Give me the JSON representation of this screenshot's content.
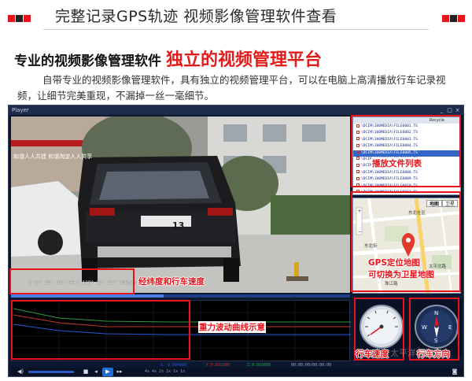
{
  "header": {
    "title": "完整记录GPS轨迹 视频影像管理软件查看",
    "accent_colors": [
      "#e8141b",
      "#222222"
    ]
  },
  "heading": {
    "black": "专业的视频影像管理软件",
    "red": "独立的视频管理平台"
  },
  "paragraph": "自带专业的视频影像管理软件，具有独立的视频管理平台，可以在电脑上高清播放行车记录视频，让细节完美重现，不漏掉一丝一毫细节。",
  "player": {
    "window_title": "Player",
    "window_buttons": [
      "_",
      "□",
      "×"
    ],
    "video": {
      "gps_overlay": "N 31° 59' 59\" 56  E 118° 23' 27\" 30km/h",
      "plate": "13",
      "street_banner": "和谐人人共建  和谐淘淀人人共享"
    },
    "seek_progress": 0.45,
    "file_list": {
      "header": "Recycle",
      "files": [
        "\\DCIM\\100MEDIA\\FILE0001.TS",
        "\\DCIM\\100MEDIA\\FILE0002.TS",
        "\\DCIM\\100MEDIA\\FILE0003.TS",
        "\\DCIM\\100MEDIA\\FILE0004.TS",
        "\\DCIM\\100MEDIA\\FILE0005.TS",
        "\\DCIM\\100MEDIA\\FILE0006.TS",
        "\\DCIM\\100MEDIA\\FILE0007.TS",
        "\\DCIM\\100MEDIA\\FILE0008.TS",
        "\\DCIM\\100MEDIA\\FILE0009.TS",
        "\\DCIM\\100MEDIA\\FILE0010.TS",
        "\\DCIM\\100MEDIA\\FILE0011.TS"
      ],
      "selected_index": 4
    },
    "map": {
      "tabs": [
        "地图",
        "卫星"
      ],
      "labels": [
        "东北街",
        "东北社区",
        "太平北路",
        "珠江路"
      ]
    },
    "graph_values": [
      {
        "text": "X:-0.004000",
        "color": "#2a56d6"
      },
      {
        "text": "Y:0.031000",
        "color": "#c0392b"
      },
      {
        "text": "Z:0.016000",
        "color": "#22a04a"
      },
      {
        "text": "00:00:00/00:00:00",
        "color": "#9aa8c4"
      }
    ],
    "controls": {
      "left_icons": [
        "volume-icon",
        "stop-icon",
        "prev-icon",
        "play-icon",
        "next-icon"
      ],
      "speed_buttons": "4x 4x 2x 2x 1x 1x",
      "camera_icon": "camera-icon"
    }
  },
  "annotations": {
    "gps_speed": "经纬度和行车速度",
    "file_list": "播放文件列表",
    "gps_map_line1": "GPS定位地图",
    "gps_map_line2": "可切换为卫星地图",
    "gravity": "重力波动曲线示意",
    "speed": "行车速度",
    "direction": "行车方向"
  },
  "watermark": "太平洋电脑网"
}
